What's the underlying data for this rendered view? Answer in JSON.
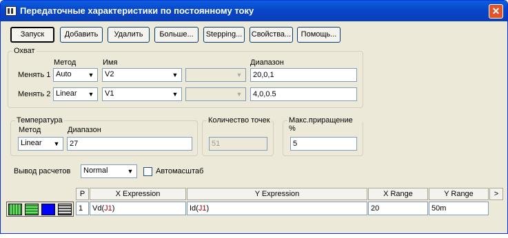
{
  "window": {
    "title": "Передаточные характеристики по постоянному току",
    "close_label": "✕"
  },
  "toolbar": {
    "run": "Запуск",
    "add": "Добавить",
    "delete": "Удалить",
    "more": "Больше...",
    "stepping": "Stepping...",
    "properties": "Свойства...",
    "help": "Помощь..."
  },
  "sweep": {
    "group_title": "Охват",
    "method_header": "Метод",
    "name_header": "Имя",
    "range_header": "Диапазон",
    "rows": [
      {
        "label": "Менять 1",
        "method": "Auto",
        "name": "V2",
        "range": "20,0,1"
      },
      {
        "label": "Менять 2",
        "method": "Linear",
        "name": "V1",
        "range": "4,0,0.5"
      }
    ]
  },
  "temperature": {
    "group_title": "Температура",
    "method_header": "Метод",
    "range_header": "Диапазон",
    "method": "Linear",
    "range": "27"
  },
  "points": {
    "group_title": "Количество точек",
    "value": "51"
  },
  "max_step": {
    "group_title": "Макс.приращение %",
    "value": "5"
  },
  "output": {
    "label": "Вывод  расчетов",
    "value": "Normal",
    "autoscale_label": "Автомасштаб"
  },
  "grid": {
    "headers": {
      "p": "P",
      "x_expr": "X Expression",
      "y_expr": "Y Expression",
      "x_range": "X Range",
      "y_range": "Y Range",
      "more": ">"
    },
    "row": {
      "p": "1",
      "x_expr_a": "Vd",
      "x_expr_b": "J1",
      "y_expr_a": "Id",
      "y_expr_b": "J1",
      "x_range": "20",
      "y_range": "50m"
    }
  },
  "colors": {
    "title_bar": "#0846c8",
    "dialog_bg": "#ece9d8",
    "close_button": "#e0542d"
  }
}
